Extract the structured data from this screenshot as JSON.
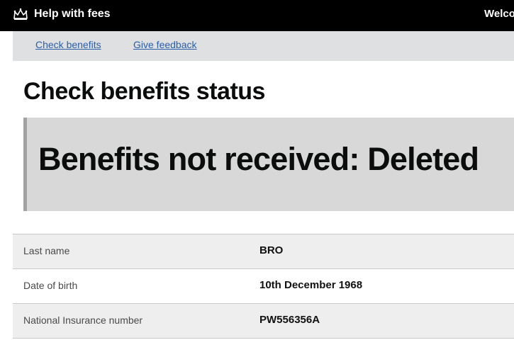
{
  "header": {
    "service_name": "Help with fees",
    "welcome_text": "Welco"
  },
  "subnav": {
    "check_benefits": "Check benefits",
    "give_feedback": "Give feedback"
  },
  "page": {
    "title": "Check benefits status",
    "status_message": "Benefits not received: Deleted"
  },
  "details": [
    {
      "label": "Last name",
      "value": "BRO"
    },
    {
      "label": "Date of birth",
      "value": "10th December 1968"
    },
    {
      "label": "National Insurance number",
      "value": "PW556356A"
    }
  ]
}
